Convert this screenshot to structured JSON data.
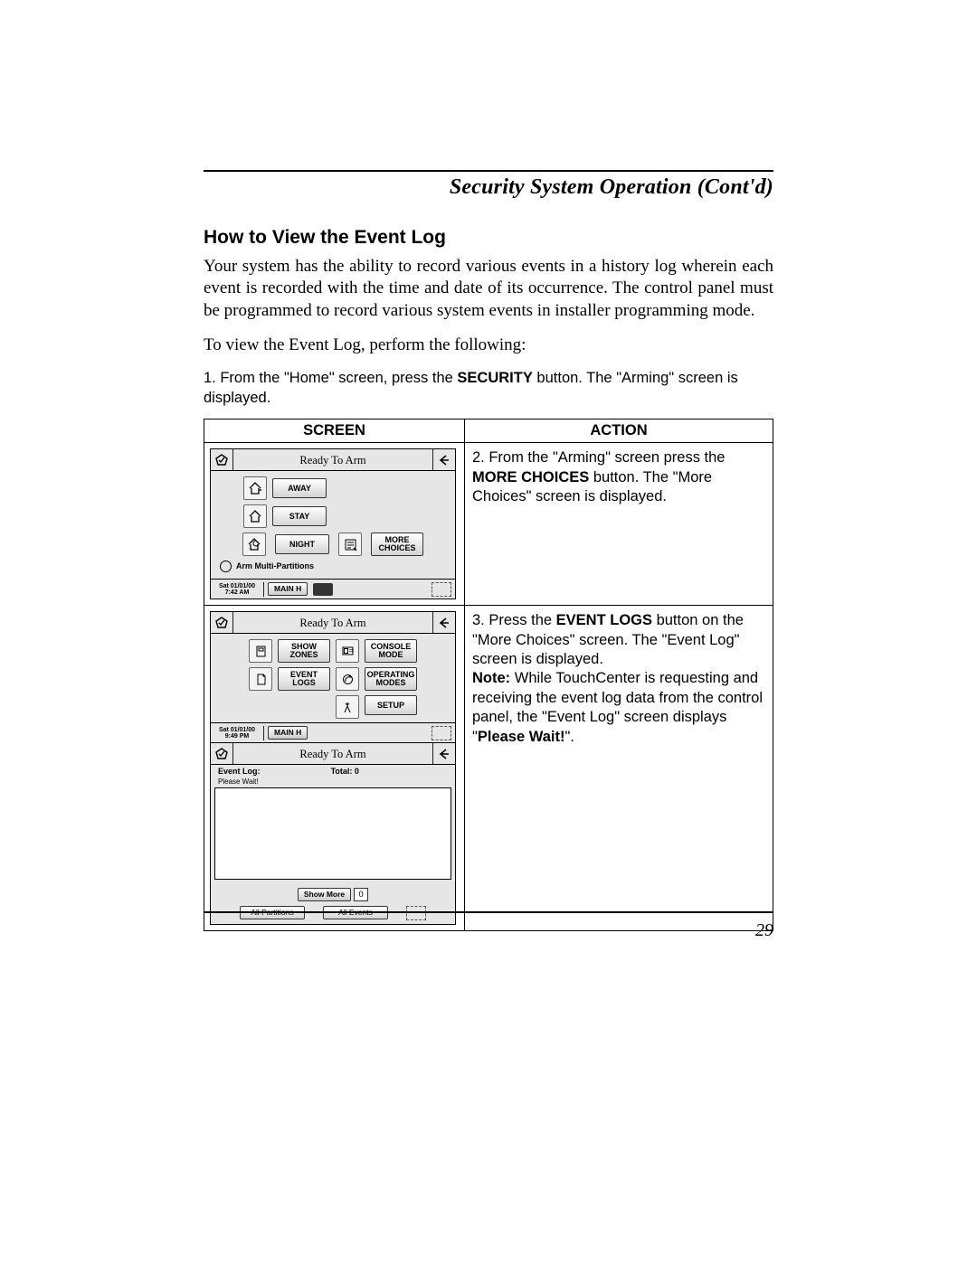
{
  "running_head": "Security System Operation (Cont'd)",
  "section_head": "How to View the Event Log",
  "intro_para": "Your system has the ability to record various events in a history log wherein each event is recorded with the time and date of its occurrence.  The control panel must be programmed to record various system events in installer programming mode.",
  "lead_in": "To view the Event Log, perform the following:",
  "step1_pre": "1.  From the \"Home\" screen, press the ",
  "step1_bold": "SECURITY",
  "step1_post": " button.  The \"Arming\" screen is displayed.",
  "table": {
    "col_screen": "SCREEN",
    "col_action": "ACTION"
  },
  "row1": {
    "action_pre": "2.  From the \"Arming\" screen press the ",
    "action_bold": "MORE CHOICES",
    "action_post": " button.  The \"More Choices\" screen is displayed."
  },
  "row2": {
    "action_pre": "3.  Press the ",
    "action_bold": "EVENT LOGS",
    "action_mid": " button on the \"More Choices\" screen.  The \"Event Log\" screen is displayed.",
    "note_label": "Note:",
    "note_mid": " While TouchCenter is requesting and receiving the event log data from the control panel, the \"Event Log\" screen displays \"",
    "note_bold": "Please Wait!",
    "note_post": "\"."
  },
  "lcd": {
    "title": "Ready To Arm",
    "away": "AWAY",
    "stay": "STAY",
    "night": "NIGHT",
    "more_choices_l1": "MORE",
    "more_choices_l2": "CHOICES",
    "arm_multi": "Arm Multi-Partitions",
    "date1_l1": "Sat 01/01/00",
    "date1_l2": "7:42 AM",
    "main_h": "MAIN H",
    "show_zones_l1": "SHOW",
    "show_zones_l2": "ZONES",
    "console_mode_l1": "CONSOLE",
    "console_mode_l2": "MODE",
    "event_logs_l1": "EVENT",
    "event_logs_l2": "LOGS",
    "operating_modes_l1": "OPERATING",
    "operating_modes_l2": "MODES",
    "setup": "SETUP",
    "date2_l1": "Sat 01/01/00",
    "date2_l2": "9:49 PM",
    "event_log_label": "Event Log:",
    "total_label": "Total:  0",
    "please_wait": "Please Wait!",
    "show_more": "Show More",
    "show_more_n": "0",
    "all_partitions": "All Partitions",
    "all_events": "All Events"
  },
  "page_number": "29"
}
